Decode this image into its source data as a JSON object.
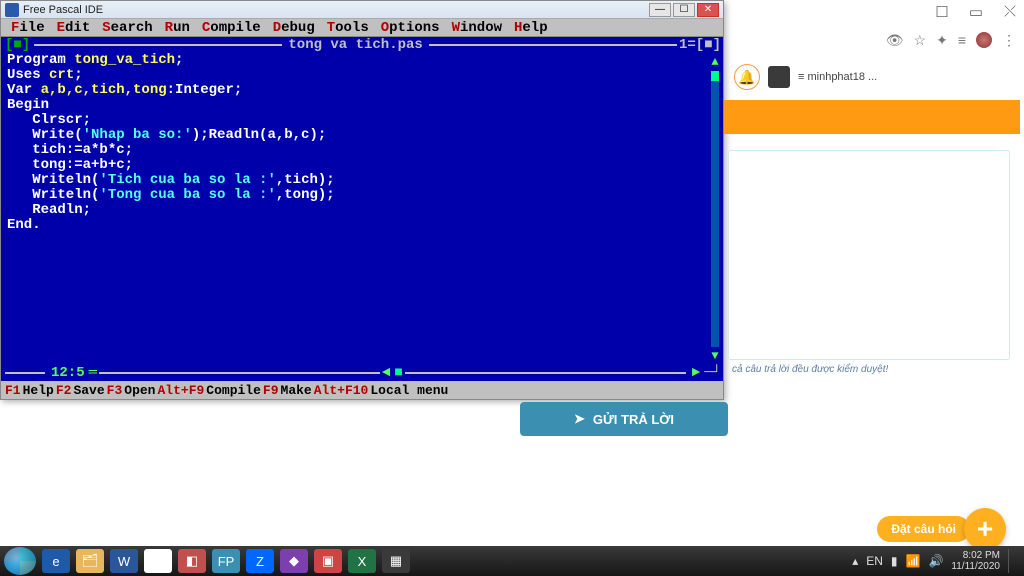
{
  "ide": {
    "window_title": "Free Pascal IDE",
    "menu": [
      {
        "hotkey": "F",
        "rest": "ile"
      },
      {
        "hotkey": "E",
        "rest": "dit"
      },
      {
        "hotkey": "S",
        "rest": "earch"
      },
      {
        "hotkey": "R",
        "rest": "un"
      },
      {
        "hotkey": "C",
        "rest": "ompile"
      },
      {
        "hotkey": "D",
        "rest": "ebug"
      },
      {
        "hotkey": "T",
        "rest": "ools"
      },
      {
        "hotkey": "O",
        "rest": "ptions"
      },
      {
        "hotkey": "W",
        "rest": "indow"
      },
      {
        "hotkey": "H",
        "rest": "elp"
      }
    ],
    "filename": "tong va tich.pas",
    "frame_right": "1=[■]",
    "cursor_pos": "12:5",
    "code_tokens": [
      [
        {
          "c": "kw",
          "t": "Program "
        },
        {
          "c": "ident",
          "t": "tong_va_tich"
        },
        {
          "c": "kw",
          "t": ";"
        }
      ],
      [
        {
          "c": "kw",
          "t": "Uses "
        },
        {
          "c": "ident",
          "t": "crt"
        },
        {
          "c": "kw",
          "t": ";"
        }
      ],
      [
        {
          "c": "kw",
          "t": "Var "
        },
        {
          "c": "ident",
          "t": "a,b,c,tich,tong"
        },
        {
          "c": "kw",
          "t": ":Integer;"
        }
      ],
      [
        {
          "c": "kw",
          "t": "Begin"
        }
      ],
      [
        {
          "c": "kw",
          "t": "   Clrscr;"
        }
      ],
      [
        {
          "c": "kw",
          "t": "   Write("
        },
        {
          "c": "str",
          "t": "'Nhap ba so:'"
        },
        {
          "c": "kw",
          "t": ");Readln(a,b,c);"
        }
      ],
      [
        {
          "c": "kw",
          "t": "   tich:=a*b*c;"
        }
      ],
      [
        {
          "c": "kw",
          "t": "   tong:=a+b+c;"
        }
      ],
      [
        {
          "c": "kw",
          "t": "   Writeln("
        },
        {
          "c": "str",
          "t": "'Tich cua ba so la :'"
        },
        {
          "c": "kw",
          "t": ",tich);"
        }
      ],
      [
        {
          "c": "kw",
          "t": "   Writeln("
        },
        {
          "c": "str",
          "t": "'Tong cua ba so la :'"
        },
        {
          "c": "kw",
          "t": ",tong);"
        }
      ],
      [
        {
          "c": "kw",
          "t": "   Readln;"
        }
      ],
      [
        {
          "c": "kw",
          "t": "End."
        }
      ]
    ],
    "status": [
      {
        "k": "F1",
        "l": " Help  "
      },
      {
        "k": "F2",
        "l": " Save  "
      },
      {
        "k": "F3",
        "l": " Open  "
      },
      {
        "k": "Alt+F9",
        "l": " Compile  "
      },
      {
        "k": "F9",
        "l": " Make  "
      },
      {
        "k": "Alt+F10",
        "l": " Local menu"
      }
    ]
  },
  "page": {
    "username": "≡ minhphat18 ...",
    "review_note": "cả câu trả lời đều được kiểm duyệt!",
    "submit_label": "GỬI TRẢ LỜI",
    "ask_label": "Đặt câu hỏi"
  },
  "taskbar": {
    "icons": [
      {
        "name": "ie-icon",
        "bg": "#1e5aa8",
        "t": "e"
      },
      {
        "name": "explorer-icon",
        "bg": "#e6b85c",
        "t": "🗂"
      },
      {
        "name": "word-icon",
        "bg": "#2b579a",
        "t": "W"
      },
      {
        "name": "chrome-icon",
        "bg": "#fff",
        "t": "◉"
      },
      {
        "name": "app-icon-1",
        "bg": "#c0504d",
        "t": "◧"
      },
      {
        "name": "app-icon-2",
        "bg": "#3b8fb0",
        "t": "FP"
      },
      {
        "name": "zalo-icon",
        "bg": "#0068ff",
        "t": "Z"
      },
      {
        "name": "app-icon-3",
        "bg": "#7b3fb0",
        "t": "◆"
      },
      {
        "name": "app-icon-4",
        "bg": "#c44",
        "t": "▣"
      },
      {
        "name": "excel-icon",
        "bg": "#217346",
        "t": "X"
      },
      {
        "name": "screenshot-icon",
        "bg": "#3a3a3a",
        "t": "▦"
      }
    ],
    "lang": "EN",
    "time": "8:02 PM",
    "date": "11/11/2020"
  }
}
